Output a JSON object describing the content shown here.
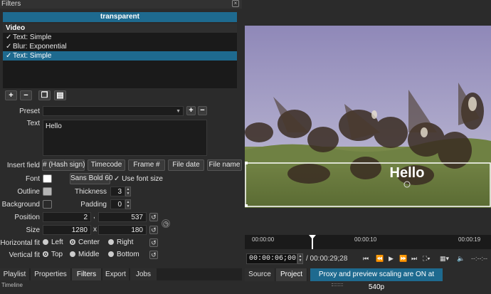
{
  "panel_title": "Filters",
  "filter_name": "transparent",
  "video_list": {
    "header": "Video",
    "items": [
      {
        "check": "✓",
        "label": "Text: Simple"
      },
      {
        "check": "✓",
        "label": "Blur: Exponential"
      },
      {
        "check": "✓",
        "label": "Text: Simple"
      }
    ]
  },
  "toolbar": {
    "add": "+",
    "remove": "−"
  },
  "preset": {
    "label": "Preset",
    "value": "",
    "add": "+",
    "remove": "−"
  },
  "text": {
    "label": "Text",
    "value": "Hello"
  },
  "insert_field": {
    "label": "Insert field",
    "buttons": [
      "# (Hash sign)",
      "Timecode",
      "Frame #",
      "File date",
      "File name"
    ]
  },
  "font": {
    "label": "Font",
    "color": "#ffffff",
    "font_button": "Sans Bold 60",
    "use_font_size_check": "✓",
    "use_font_size": "Use font size"
  },
  "outline": {
    "label": "Outline",
    "color": "#b5b5b5",
    "thickness_label": "Thickness",
    "thickness": "3"
  },
  "background": {
    "label": "Background",
    "color": "#2a2a2a",
    "padding_label": "Padding",
    "padding": "0"
  },
  "position": {
    "label": "Position",
    "x": "2",
    "sep": ",",
    "y": "537"
  },
  "size": {
    "label": "Size",
    "w": "1280",
    "sep": "x",
    "h": "180"
  },
  "hfit": {
    "label": "Horizontal fit",
    "options": [
      "Left",
      "Center",
      "Right"
    ],
    "selected": "Center"
  },
  "vfit": {
    "label": "Vertical fit",
    "options": [
      "Top",
      "Middle",
      "Bottom"
    ],
    "selected": "Top"
  },
  "tabs": [
    "Playlist",
    "Properties",
    "Filters",
    "Export",
    "Jobs"
  ],
  "active_tab": "Filters",
  "bottom_cut": "Timeline",
  "video_overlay_text": "Hello",
  "timeline": {
    "ticks": [
      "00:00:00",
      "00:00:10",
      "00:00:19"
    ]
  },
  "transport": {
    "current": "00:00:06;00",
    "total": "/ 00:00:29;28",
    "trailing": "--:--:--"
  },
  "view_tabs": [
    "Source",
    "Project"
  ],
  "status_message": "Proxy and preview scaling are ON at 540p",
  "colors": {
    "accent": "#1e6a8f",
    "panel": "#2b2b2b"
  }
}
